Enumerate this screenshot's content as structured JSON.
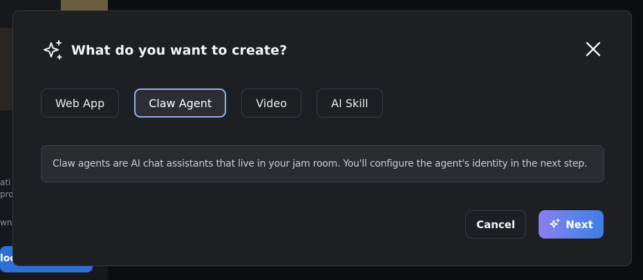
{
  "background": {
    "partial_lines": [
      "ati",
      "pro",
      "wne"
    ],
    "blue_button_label": "loo"
  },
  "modal": {
    "title": "What do you want to create?",
    "title_icon": "sparkle-icon",
    "close_icon": "close-icon",
    "tabs": [
      {
        "label": "Web App",
        "selected": false
      },
      {
        "label": "Claw Agent",
        "selected": true
      },
      {
        "label": "Video",
        "selected": false
      },
      {
        "label": "AI Skill",
        "selected": false
      }
    ],
    "description": "Claw agents are AI chat assistants that live in your jam room. You'll configure the agent's identity in the next step.",
    "cancel_label": "Cancel",
    "next_label": "Next",
    "next_icon": "sparkle-icon"
  },
  "colors": {
    "selected_tab_border": "#8db6ee",
    "next_gradient_start": "#8c7df0",
    "next_gradient_end": "#3f7ce3"
  }
}
